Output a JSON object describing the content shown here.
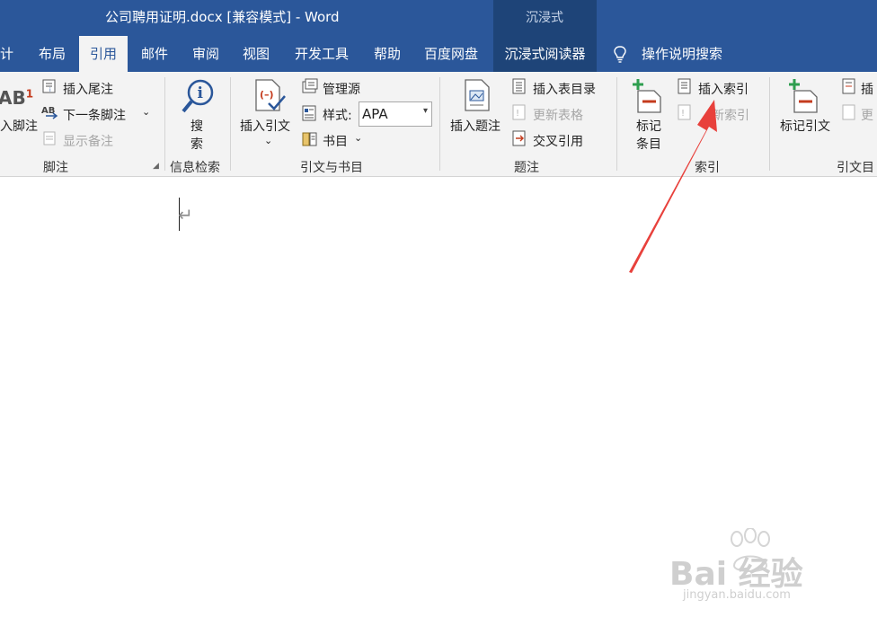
{
  "window": {
    "title": "公司聘用证明.docx [兼容模式]  -  Word",
    "immersive_header": "沉浸式"
  },
  "tabs": [
    {
      "label": "计"
    },
    {
      "label": "布局"
    },
    {
      "label": "引用"
    },
    {
      "label": "邮件"
    },
    {
      "label": "审阅"
    },
    {
      "label": "视图"
    },
    {
      "label": "开发工具"
    },
    {
      "label": "帮助"
    },
    {
      "label": "百度网盘"
    },
    {
      "label": "沉浸式阅读器"
    },
    {
      "label": "操作说明搜索"
    }
  ],
  "ribbon": {
    "footnote": {
      "insert_footnote_partial": "入脚注",
      "insert_endnote": "插入尾注",
      "next_footnote": "下一条脚注",
      "show_notes": "显示备注",
      "group": "脚注",
      "ab_glyph": "AB",
      "superscript": "1"
    },
    "research": {
      "search_line1": "搜",
      "search_line2": "索",
      "group": "信息检索"
    },
    "citations": {
      "insert_citation": "插入引文",
      "manage_sources": "管理源",
      "style_label": "样式:",
      "style_value": "APA",
      "bibliography": "书目",
      "group": "引文与书目"
    },
    "captions": {
      "insert_caption": "插入题注",
      "insert_table_of_figures": "插入表目录",
      "update_table": "更新表格",
      "cross_reference": "交叉引用",
      "group": "题注"
    },
    "index": {
      "mark_entry_line1": "标记",
      "mark_entry_line2": "条目",
      "insert_index": "插入索引",
      "update_index_partial": "新索引",
      "group_partial": "索引"
    },
    "toa": {
      "mark_citation": "标记引文",
      "insert_toa_partial": "插",
      "update_partial": "更",
      "group_partial": "引文目"
    }
  },
  "watermark": {
    "brand": "Bai 经验",
    "url": "jingyan.baidu.com"
  },
  "colors": {
    "title_bar": "#2b579a",
    "ribbon_bg": "#f3f3f3",
    "arrow": "#e8413c"
  }
}
